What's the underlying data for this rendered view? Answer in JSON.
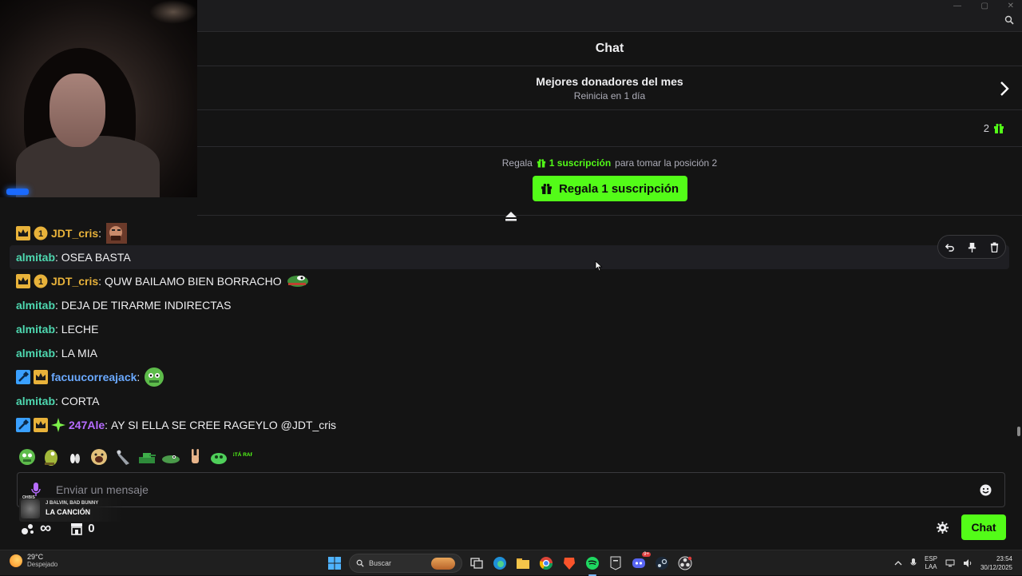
{
  "window": {
    "minimize": "—",
    "maximize": "▢",
    "close": "✕"
  },
  "chat": {
    "title": "Chat"
  },
  "donors": {
    "title": "Mejores donadores del mes",
    "subtitle": "Reinicia en 1 día"
  },
  "rank": {
    "position": "2"
  },
  "promo": {
    "prefix": "Regala",
    "highlight": "1 suscripción",
    "suffix": "para tomar la posición 2",
    "button": "Regala 1 suscripción"
  },
  "messages": [
    {
      "user": "JDT_cris",
      "badges": [
        "crown",
        "sub-1"
      ],
      "text": "",
      "emote": "meme-face"
    },
    {
      "user": "almitab",
      "badges": [],
      "text": "OSEA BASTA"
    },
    {
      "user": "JDT_cris",
      "badges": [
        "crown",
        "sub-1"
      ],
      "text": "QUW BAILAMO BIEN BORRACHO",
      "emote": "pepe-dance"
    },
    {
      "user": "almitab",
      "badges": [],
      "text": "DEJA DE TIRARME INDIRECTAS"
    },
    {
      "user": "almitab",
      "badges": [],
      "text": "LECHE"
    },
    {
      "user": "almitab",
      "badges": [],
      "text": "LA MIA"
    },
    {
      "user": "facuucorreajack",
      "badges": [
        "mod",
        "crown"
      ],
      "text": "",
      "emote": "pepe-green"
    },
    {
      "user": "almitab",
      "badges": [],
      "text": "CORTA"
    },
    {
      "user": "247Ale",
      "badges": [
        "mod",
        "crown",
        "sparkle"
      ],
      "text": "AY SI ELLA SE CREE RAGEYLO @JDT_cris"
    }
  ],
  "separator": ":",
  "sub_badge": "1",
  "emote_bar": [
    "pepe-green",
    "pepe-dance",
    "clap",
    "kekw",
    "bird",
    "tank",
    "croc",
    "rock-hand",
    "slime",
    "esta-rara"
  ],
  "emote_text": "ESTÁ RARA",
  "input": {
    "placeholder": "Enviar un mensaje"
  },
  "music": {
    "overlay": "OHBIS",
    "artist": "J BALVIN, BAD BUNNY",
    "song": "LA CANCIÓN"
  },
  "bottom": {
    "points": "∞",
    "store_count": "0",
    "chat_button": "Chat"
  },
  "taskbar": {
    "temp": "29°C",
    "weather": "Despejado",
    "search": "Buscar",
    "lang_top": "ESP",
    "lang_bottom": "LAA",
    "time": "23:54",
    "date": "30/12/2025",
    "discord_badge": "9+"
  },
  "colors": {
    "accent": "#53fc18",
    "gold": "#e8b23a",
    "teal": "#4ed8b0",
    "blue": "#6aa9ff",
    "purple": "#b66cff"
  }
}
